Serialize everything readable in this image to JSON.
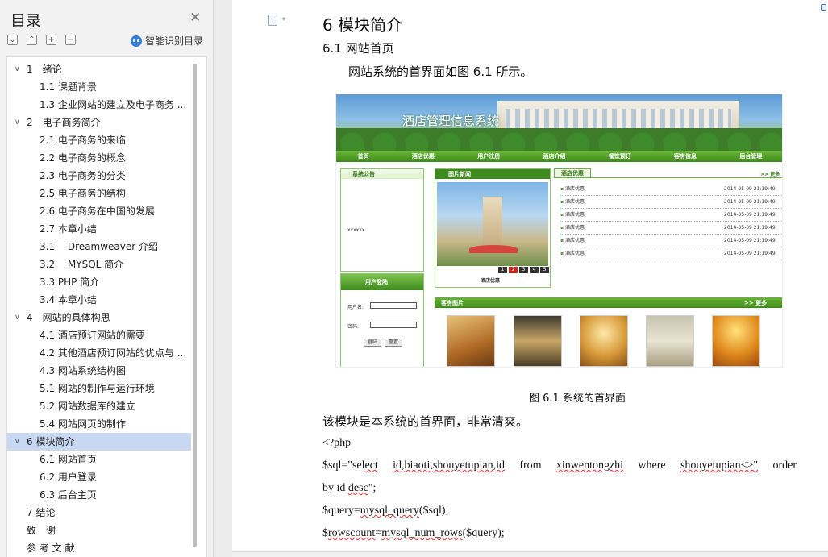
{
  "sidebar": {
    "title": "目录",
    "ai_label": "智能识别目录",
    "toc": [
      {
        "label": "1　绪论",
        "level": 1,
        "caret": "∨"
      },
      {
        "label": "1.1  课题背景",
        "level": 2
      },
      {
        "label": "1.3  企业网站的建立及电子商务 ...",
        "level": 2
      },
      {
        "label": "2　电子商务简介",
        "level": 1,
        "caret": "∨"
      },
      {
        "label": "2.1  电子商务的来临",
        "level": 2
      },
      {
        "label": "2.2  电子商务的概念",
        "level": 2
      },
      {
        "label": "2.3  电子商务的分类",
        "level": 2
      },
      {
        "label": "2.5  电子商务的结构",
        "level": 2
      },
      {
        "label": "2.6  电子商务在中国的发展",
        "level": 2
      },
      {
        "label": "2.7  本章小结",
        "level": 2
      },
      {
        "label": "3.1　 Dreamweaver 介绍",
        "level": 2
      },
      {
        "label": "3.2　 MYSQL 简介",
        "level": 2
      },
      {
        "label": "3.3 PHP 简介",
        "level": 2
      },
      {
        "label": "3.4  本章小结",
        "level": 2
      },
      {
        "label": "4　网站的具体构思",
        "level": 1,
        "caret": "∨"
      },
      {
        "label": "4.1  酒店预订网站的需要",
        "level": 2
      },
      {
        "label": "4.2  其他酒店预订网站的优点与 ...",
        "level": 2
      },
      {
        "label": "4.3  网站系统结构图",
        "level": 2
      },
      {
        "label": "5.1  网站的制作与运行环境",
        "level": 2
      },
      {
        "label": "5.2  网站数据库的建立",
        "level": 2
      },
      {
        "label": "5.4  网站网页的制作",
        "level": 2
      },
      {
        "label": "6  模块简介",
        "level": 1,
        "caret": "∨",
        "selected": true
      },
      {
        "label": "6.1  网站首页",
        "level": 2
      },
      {
        "label": "6.2  用户登录",
        "level": 2
      },
      {
        "label": "6.3 后台主页",
        "level": 2
      },
      {
        "label": "7  结论",
        "level": 1
      },
      {
        "label": "致　谢",
        "level": 1
      },
      {
        "label": "参 考 文 献",
        "level": 1
      }
    ]
  },
  "doc": {
    "heading": "6  模块简介",
    "subheading": "6.1  网站首页",
    "intro": "网站系统的首界面如图 6.1 所示。",
    "caption": "图 6.1 系统的首界面",
    "para": "该模块是本系统的首界面，非常清爽。",
    "code": {
      "l1": "<?php",
      "l2_a": "$sql=\"sel",
      "l2_b": "ect",
      "l2_c": "id,biaoti,shouyetupian,id",
      "l2_d": "from",
      "l2_e": "xinwentongzhi",
      "l2_f": "where",
      "l2_g": "shouyetupian<>\"",
      "l2_h": "order",
      "l3_a": "by id ",
      "l3_b": "desc",
      "l3_c": "\";",
      "l4_a": "$query=",
      "l4_b": "mysql_query",
      "l4_c": "($sql);",
      "l5_a": "$",
      "l5_b": "rowscount",
      "l5_c": "=",
      "l5_d": "mysql_num_rows",
      "l5_e": "($query);"
    }
  },
  "figure": {
    "banner_title": "酒店管理信息系统",
    "nav": [
      "首页",
      "酒店优惠",
      "用户注册",
      "酒店介绍",
      "餐饮预订",
      "客房信息",
      "后台管理"
    ],
    "notice_title": "系统公告",
    "notice_text": "xxxxxx",
    "photo_title": "图片新闻",
    "photo_caption": "酒店优惠",
    "pager": [
      "1",
      "2",
      "3",
      "4",
      "5"
    ],
    "news_tab": "酒店优惠",
    "news_more": ">> 更多",
    "news_items": [
      {
        "title": "酒店优惠",
        "date": "2014-05-09 21:19:49"
      },
      {
        "title": "酒店优惠",
        "date": "2014-05-09 21:19:49"
      },
      {
        "title": "酒店优惠",
        "date": "2014-05-09 21:19:49"
      },
      {
        "title": "酒店优惠",
        "date": "2014-05-09 21:19:49"
      },
      {
        "title": "酒店优惠",
        "date": "2014-05-09 21:19:49"
      },
      {
        "title": "酒店优惠",
        "date": "2014-05-09 21:19:49"
      }
    ],
    "login_title": "用户登陆",
    "user_label": "用户名:",
    "pass_label": "密码:",
    "login_btn": "登陆",
    "reset_btn": "重置",
    "rooms_title": "客房图片",
    "rooms_more": ">> 更多",
    "colors": {
      "green": "#3f8a20",
      "light_green": "#8bc86a",
      "selected_toc": "#c9d8f2"
    }
  }
}
